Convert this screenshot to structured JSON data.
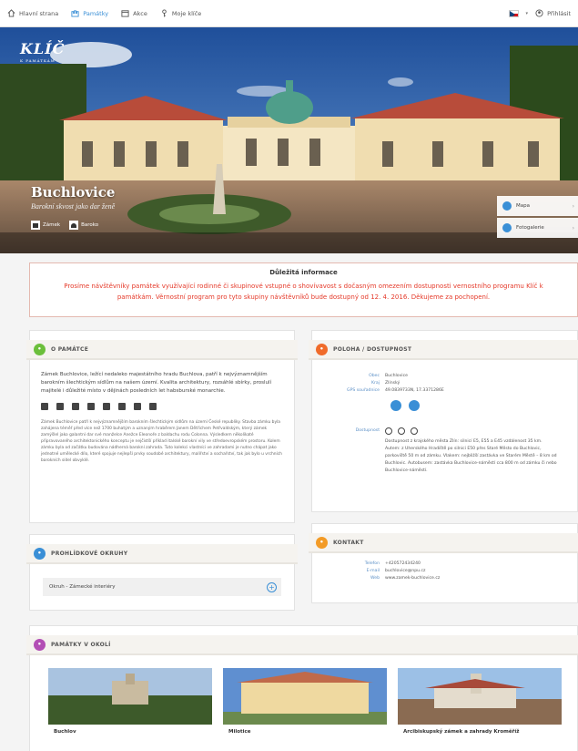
{
  "nav": {
    "items": [
      {
        "label": "Hlavní strana",
        "icon": "home-icon"
      },
      {
        "label": "Památky",
        "icon": "castle-icon"
      },
      {
        "label": "Akce",
        "icon": "calendar-icon"
      },
      {
        "label": "Moje klíče",
        "icon": "key-icon"
      }
    ],
    "login": "Přihlásit"
  },
  "hero": {
    "logo_word": "KLÍČ",
    "logo_sub": "K PAMÁTKÁM",
    "title": "Buchlovice",
    "subtitle": "Barokní skvost jako dar ženě",
    "tags": [
      "Zámek",
      "Baroko"
    ],
    "side_buttons": [
      "Mapa",
      "Fotogalerie"
    ]
  },
  "info": {
    "title": "Důležitá informace",
    "text": "Prosíme návštěvníky památek využívající rodinné či skupinové vstupné o shovívavost s dočasným omezením dostupnosti vernostního programu Klíč k památkám. Věrnostní program pro tyto skupiny návštěvníků bude dostupný od 12. 4. 2016. Děkujeme za pochopení."
  },
  "about": {
    "header": "O PAMÁTCE",
    "intro": "Zámek Buchlovice, ležící nedaleko majestátního hradu Buchlova, patří k nejvýznamnějším barokním šlechtickým sídlům na našem území. Kvalita architektury, rozsáhlé sbírky, proslulí majitelé i důležité místo v dějinách posledních let habsburské monarchie.",
    "body": "Zámek Buchlovice patří k nejvýznamnějším barokním šlechtickým sídlům na území České republiky. Stavba zámku byla zahájena téměř před více než 1700 buhatým a uznaným hraběrem Janem Dětřichem Petřvaldským, který zámek zamýšlel jako galantní dar své manželce Anežce Eleonoře z baldachu rodu Colonna. Výsledkem několikaté připravovaného architektonického konceptu je nejčistší příklad italské barokní vily ve středoevropském prostoru. Kolem zámku byla od začátku budována nádherná barokní zahrada. Tuto kolekci vlastníci ve zahradami je nutno chápat jako jednotné umělecké dílo, které spojuje nejlepší prvky soudobé architektury, malířství a sochařství, tak jak bylo u vrchních barokních sídel obvyklé."
  },
  "location": {
    "header": "POLOHA / DOSTUPNOST",
    "rows": [
      {
        "k": "Obec",
        "v": "Buchlovice"
      },
      {
        "k": "Kraj",
        "v": "Zlínský"
      },
      {
        "k": "GPS souřadnice",
        "v": "49.0839733N, 17.3371286E"
      }
    ],
    "access_label": "Dostupnost",
    "access_text": "Dostupnost z krajského města Zlín: silnicí E5, E55 a E45 vzdálenost 35 km. Autem: z Uherského Hradiště po silnici E50 přes Staré Město do Buchlovic, parkoviště 50 m od zámku. Vlakem: nejbližší zastávka ve Starém Městě – 8 km od Buchlovic. Autobusem: zastávka Buchlovice-náměstí cca 800 m od zámku či nebo Buchlovice-náměstí."
  },
  "tours": {
    "header": "PROHLÍDKOVÉ OKRUHY",
    "items": [
      "Okruh - Zámecké interiéry"
    ]
  },
  "contact": {
    "header": "KONTAKT",
    "rows": [
      {
        "k": "Telefon",
        "v": "+420572434240"
      },
      {
        "k": "E-mail",
        "v": "buchlovice@npu.cz"
      },
      {
        "k": "Web",
        "v": "www.zamek-buchlovice.cz"
      }
    ]
  },
  "nearby": {
    "header": "PAMÁTKY V OKOLÍ",
    "cards": [
      "Buchlov",
      "Milotice",
      "Arcibiskupský zámek a zahrady Kroměříž"
    ]
  },
  "colors": {
    "accent": "#3a8fd6",
    "green": "#6bbf3b",
    "orange": "#f39b26",
    "purple": "#b34fb5",
    "red": "#e53a2a"
  }
}
